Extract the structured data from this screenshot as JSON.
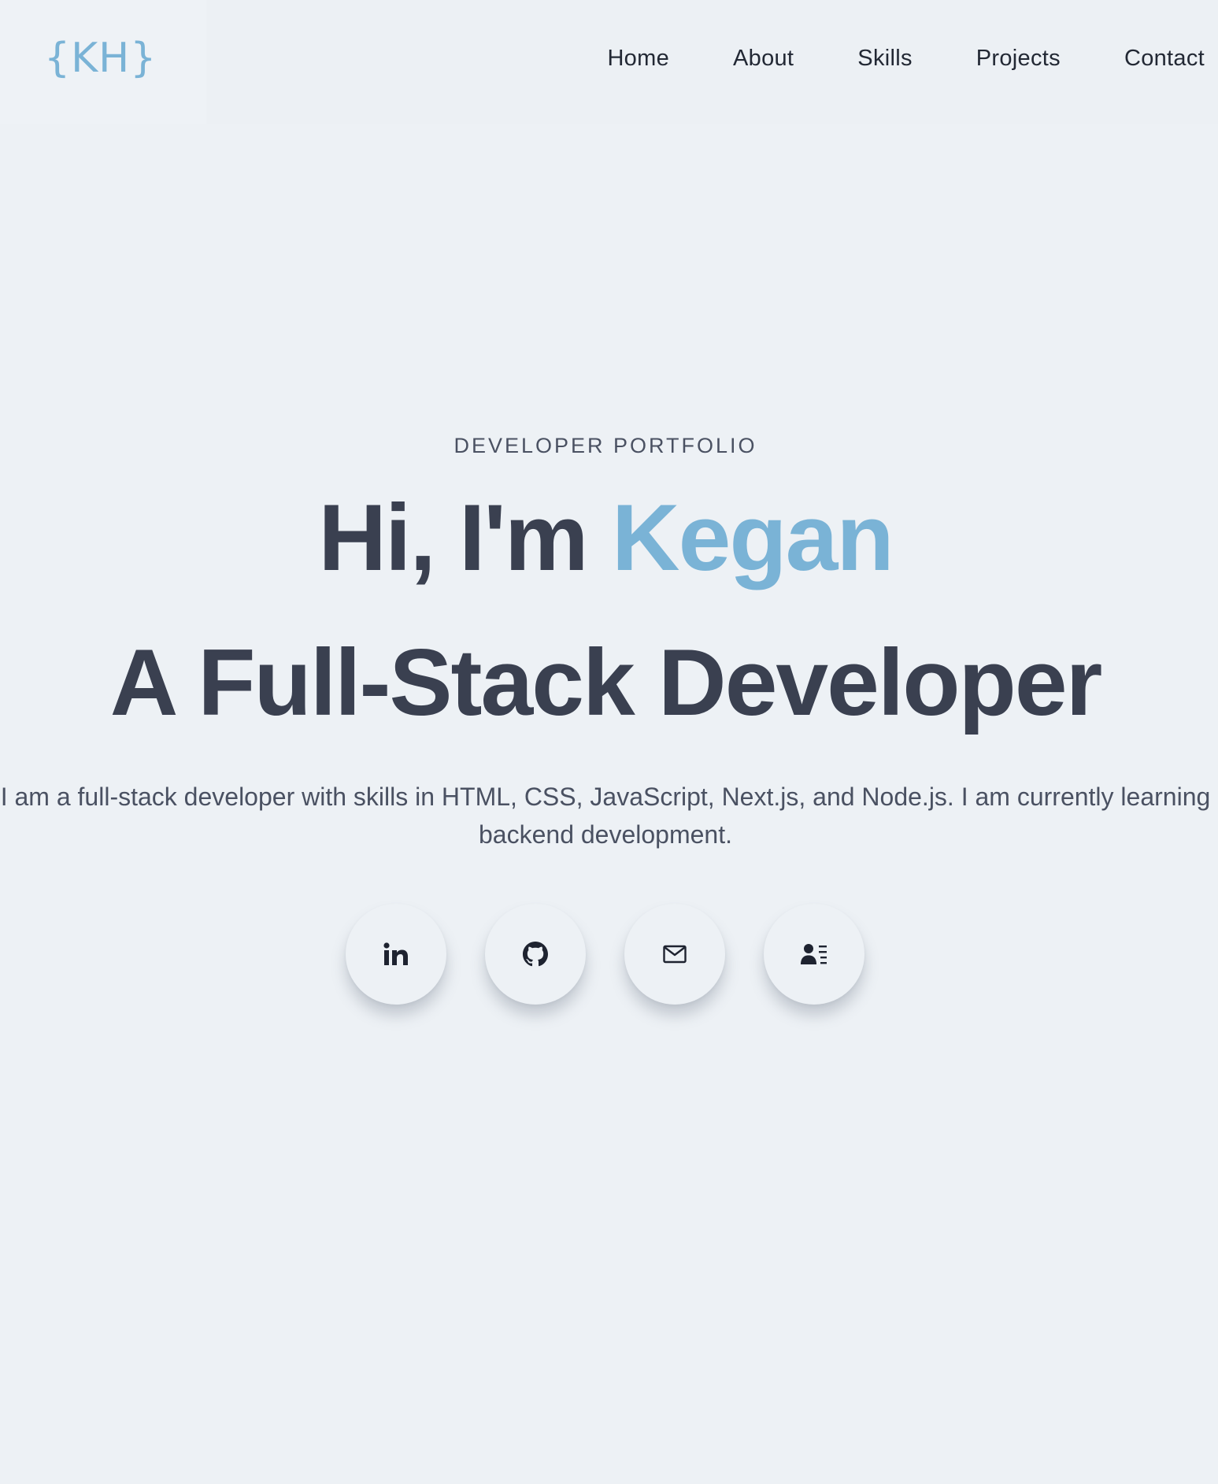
{
  "header": {
    "logo": "{KH}",
    "nav": [
      {
        "label": "Home"
      },
      {
        "label": "About"
      },
      {
        "label": "Skills"
      },
      {
        "label": "Projects"
      },
      {
        "label": "Contact"
      }
    ]
  },
  "hero": {
    "eyebrow": "DEVELOPER PORTFOLIO",
    "greeting_prefix": "Hi, I'm ",
    "name": "Kegan",
    "title": "A Full-Stack Developer",
    "intro": "I am a full-stack developer with skills in HTML, CSS, JavaScript, Next.js, and Node.js. I am currently learning backend development."
  },
  "socials": [
    {
      "icon": "linkedin-icon"
    },
    {
      "icon": "github-icon"
    },
    {
      "icon": "mail-icon"
    },
    {
      "icon": "contact-card-icon"
    }
  ],
  "colors": {
    "background": "#edf1f5",
    "accent": "#7ab3d6",
    "heading": "#3a4050",
    "body_text": "#4a5162",
    "nav_text": "#222834"
  }
}
